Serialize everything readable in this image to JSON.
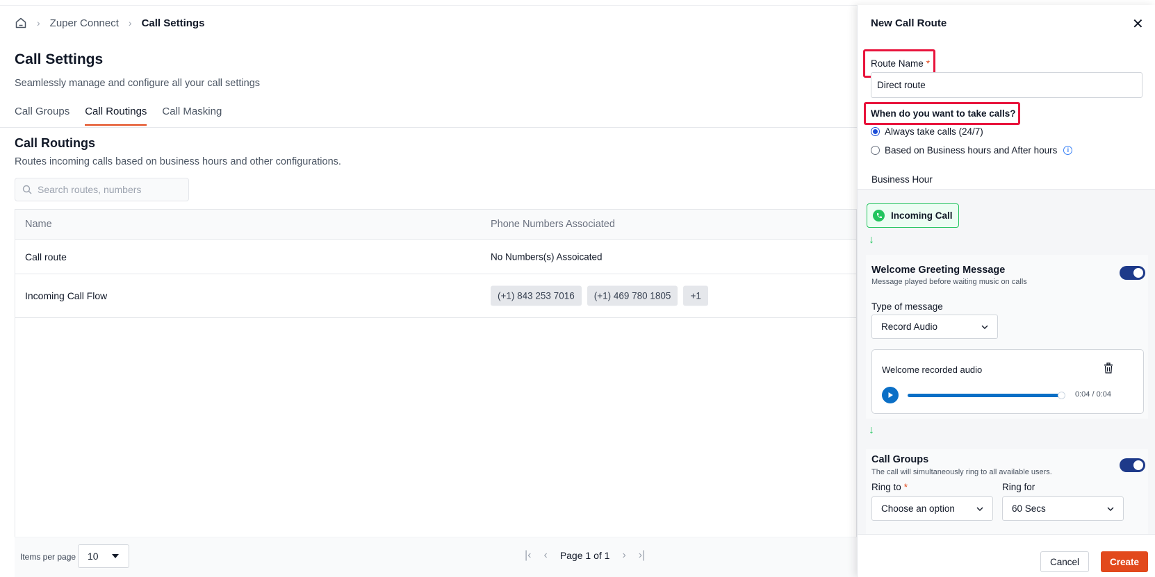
{
  "breadcrumb": {
    "home_icon": "home-icon",
    "items": [
      "Zuper Connect",
      "Call Settings"
    ],
    "separator": "›"
  },
  "page": {
    "title": "Call Settings",
    "subtitle": "Seamlessly manage and configure all your call settings"
  },
  "tabs": [
    {
      "label": "Call Groups",
      "active": false
    },
    {
      "label": "Call Routings",
      "active": true
    },
    {
      "label": "Call Masking",
      "active": false
    }
  ],
  "section": {
    "title": "Call Routings",
    "subtitle": "Routes incoming calls based on business hours and other configurations."
  },
  "search": {
    "placeholder": "Search routes, numbers",
    "value": ""
  },
  "table": {
    "columns": [
      "Name",
      "Phone Numbers Associated"
    ],
    "rows": [
      {
        "name": "Call route",
        "phone_text": "No Numbers(s) Assoicated",
        "chips": []
      },
      {
        "name": "Incoming Call Flow",
        "phone_text": "",
        "chips": [
          "(+1) 843 253 7016",
          "(+1) 469 780 1805",
          "+1"
        ]
      }
    ]
  },
  "pagination": {
    "items_per_page_label": "Items per page",
    "items_per_page": "10",
    "page_text": "Page 1 of 1"
  },
  "panel": {
    "title": "New Call Route",
    "route_name_label": "Route Name",
    "required_mark": "*",
    "route_name_value": "Direct route",
    "when_label": "When do you want to take calls?",
    "options": [
      {
        "label": "Always take calls (24/7)",
        "checked": true
      },
      {
        "label": "Based on Business hours and After hours",
        "checked": false
      }
    ],
    "subtab": "Business Hour",
    "incoming_label": "Incoming Call",
    "arrow": "↓",
    "greeting": {
      "title": "Welcome Greeting Message",
      "desc": "Message played before waiting music on calls",
      "enabled": true,
      "type_label": "Type of message",
      "type_value": "Record Audio",
      "audio_title": "Welcome recorded audio",
      "audio_time": "0:04 / 0:04",
      "progress": 1.0
    },
    "groups": {
      "title": "Call Groups",
      "desc": "The call will simultaneously ring to all available users.",
      "enabled": true,
      "ring_to_label": "Ring to",
      "ring_to_value": "Choose an option",
      "ring_for_label": "Ring for",
      "ring_for_value": "60 Secs"
    },
    "cancel_label": "Cancel",
    "create_label": "Create"
  },
  "colors": {
    "accent": "#e2491c",
    "highlight": "#e8143c",
    "toggle": "#1e3a8a",
    "audio": "#0b6fc6",
    "success": "#22c55e"
  }
}
